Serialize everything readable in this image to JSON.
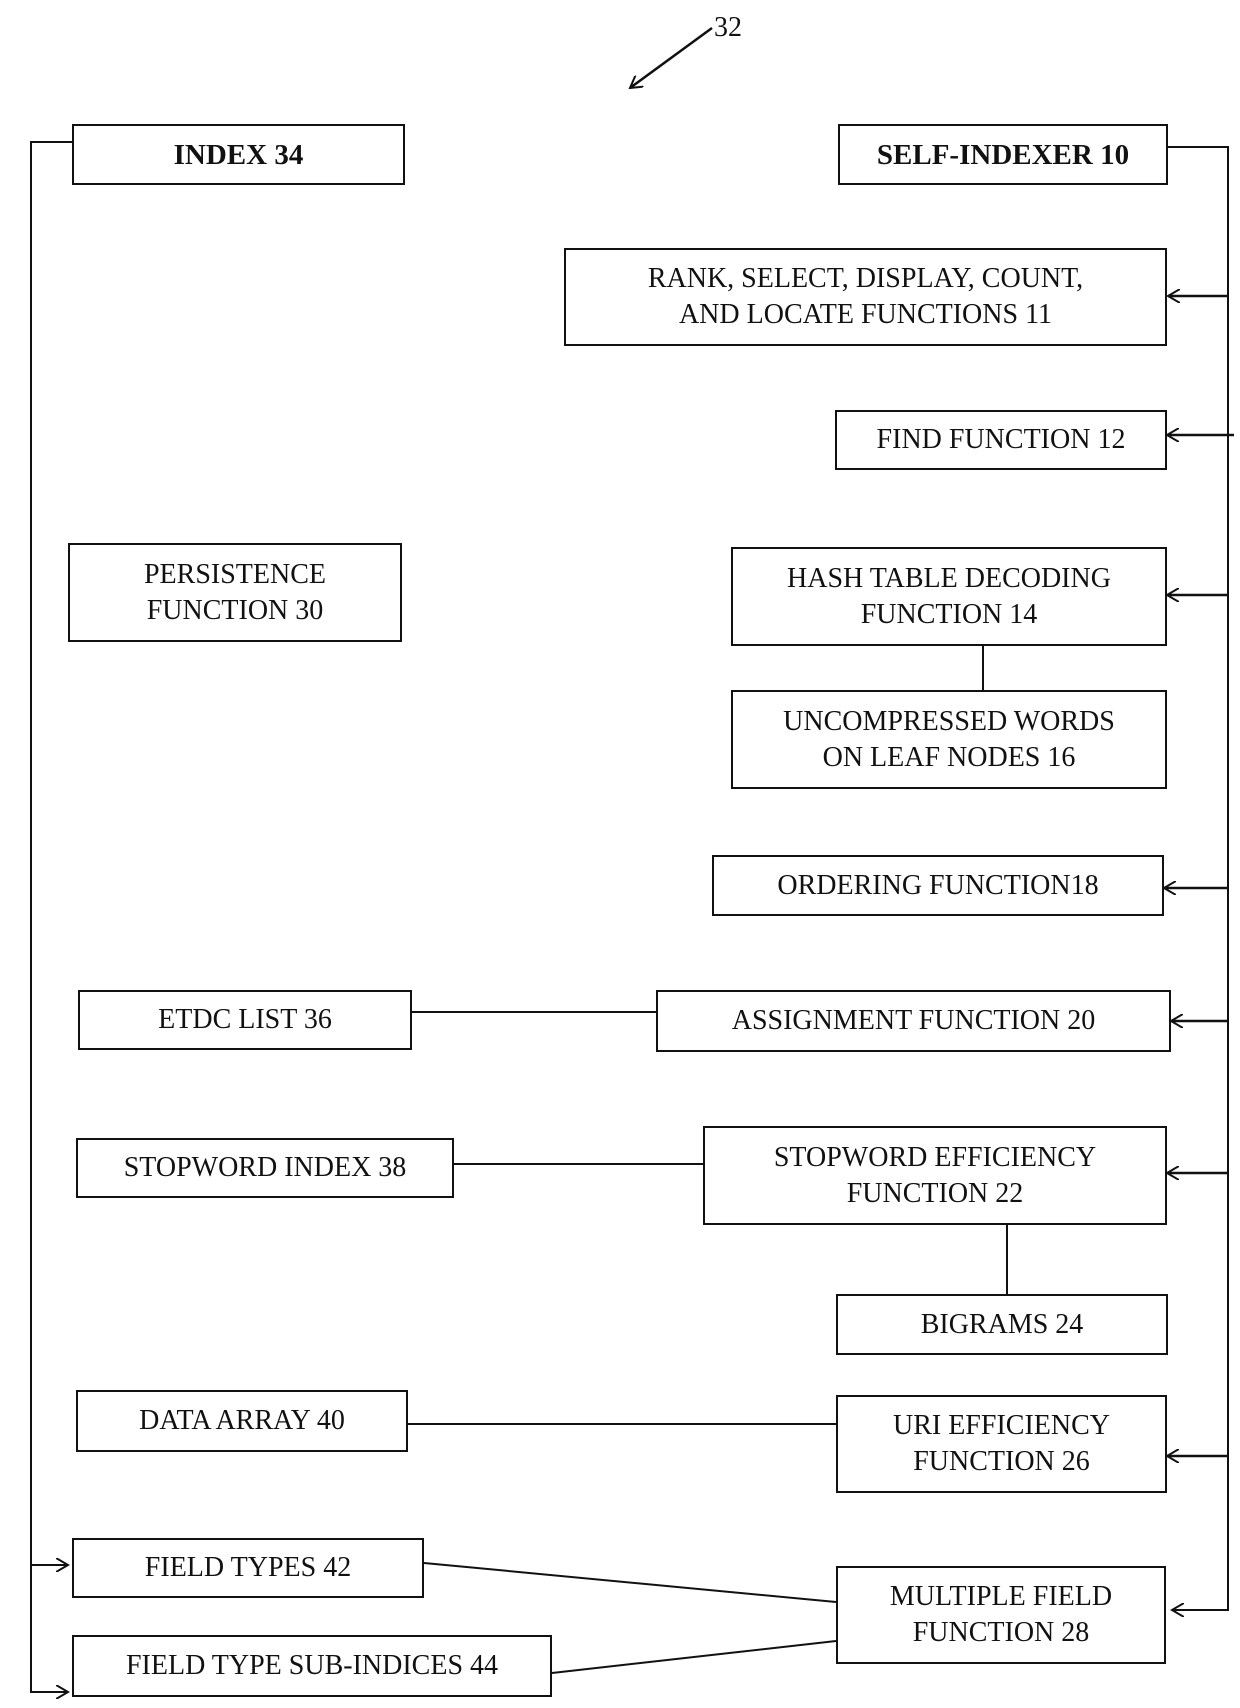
{
  "figure": {
    "reference_label": "32",
    "colors": {
      "line": "#111111",
      "background": "#ffffff"
    }
  },
  "left_column": {
    "index": "INDEX 34",
    "persistence": "PERSISTENCE\nFUNCTION 30",
    "etdc_list": "ETDC LIST 36",
    "stopword_index": "STOPWORD INDEX 38",
    "data_array": "DATA ARRAY 40",
    "field_types": "FIELD TYPES 42",
    "field_type_sub_indices": "FIELD TYPE SUB-INDICES 44"
  },
  "right_column": {
    "self_indexer": "SELF-INDEXER 10",
    "rank_select": "RANK, SELECT, DISPLAY, COUNT,\nAND LOCATE FUNCTIONS 11",
    "find_function": "FIND FUNCTION 12",
    "hash_table": "HASH TABLE DECODING\nFUNCTION 14",
    "uncompressed_words": "UNCOMPRESSED WORDS\nON LEAF NODES 16",
    "ordering_function": "ORDERING FUNCTION18",
    "assignment_function": "ASSIGNMENT FUNCTION 20",
    "stopword_efficiency": "STOPWORD EFFICIENCY\nFUNCTION 22",
    "bigrams": "BIGRAMS 24",
    "uri_efficiency": "URI EFFICIENCY\nFUNCTION 26",
    "multiple_field": "MULTIPLE FIELD\nFUNCTION 28"
  }
}
